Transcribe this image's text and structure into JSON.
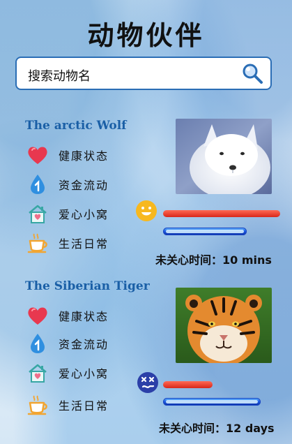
{
  "app": {
    "title": "动物伙伴"
  },
  "search": {
    "text": "搜索动物名"
  },
  "menu_labels": {
    "health": "健康状态",
    "funds": "资金流动",
    "home": "爱心小窝",
    "daily": "生活日常"
  },
  "colors": {
    "accent": "#2a6db5",
    "health_bar": "#d8271a",
    "fund_bar": "#1f5ee8",
    "animal_name": "#1a5fa6"
  },
  "animals": [
    {
      "name": "The arctic Wolf",
      "mood_icon": "happy-face-icon",
      "health_level": 1.0,
      "fund_level": 1.0,
      "status_text": "未关心时间：10 mins"
    },
    {
      "name": "The Siberian Tiger",
      "mood_icon": "dizzy-face-icon",
      "health_level": 0.42,
      "fund_level": 1.0,
      "status_text": "未关心时间：12 days"
    }
  ]
}
